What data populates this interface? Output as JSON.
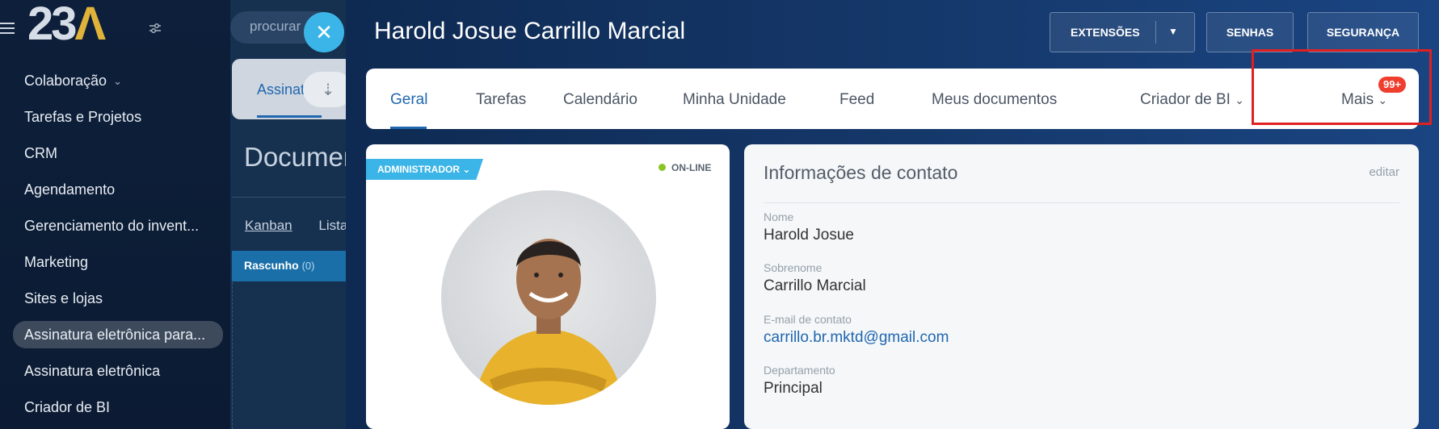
{
  "sidebar": {
    "logo_main": "23",
    "logo_accent": "Λ",
    "items": [
      {
        "label": "Colaboração",
        "chevron": "⌄"
      },
      {
        "label": "Tarefas e Projetos"
      },
      {
        "label": "CRM"
      },
      {
        "label": "Agendamento"
      },
      {
        "label": "Gerenciamento do invent..."
      },
      {
        "label": "Marketing"
      },
      {
        "label": "Sites e lojas"
      },
      {
        "label": "Assinatura eletrônica para..."
      },
      {
        "label": "Assinatura eletrônica"
      },
      {
        "label": "Criador de BI"
      }
    ]
  },
  "background": {
    "search_placeholder": "procurar",
    "tab_label": "Assinat",
    "page_title": "Documer",
    "view_tabs": [
      "Kanban",
      "Lista"
    ],
    "column_title": "Rascunho",
    "column_count": "(0)"
  },
  "profile": {
    "name": "Harold Josue Carrillo Marcial",
    "buttons": {
      "extensions": "EXTENSÕES",
      "passwords": "SENHAS",
      "security": "SEGURANÇA"
    },
    "tabs": [
      "Geral",
      "Tarefas",
      "Calendário",
      "Minha Unidade",
      "Feed",
      "Meus documentos",
      "Criador de BI",
      "Mais"
    ],
    "more_badge": "99+",
    "role": "ADMINISTRADOR",
    "status": "ON-LINE",
    "contact": {
      "title": "Informações de contato",
      "edit": "editar",
      "fields": [
        {
          "label": "Nome",
          "value": "Harold Josue"
        },
        {
          "label": "Sobrenome",
          "value": "Carrillo Marcial"
        },
        {
          "label": "E-mail de contato",
          "value": "carrillo.br.mktd@gmail.com"
        },
        {
          "label": "Departamento",
          "value": "Principal"
        }
      ]
    }
  },
  "colors": {
    "accent": "#2067b0",
    "online": "#8bc425",
    "highlight": "#e02020",
    "badge": "#f03e2e"
  }
}
